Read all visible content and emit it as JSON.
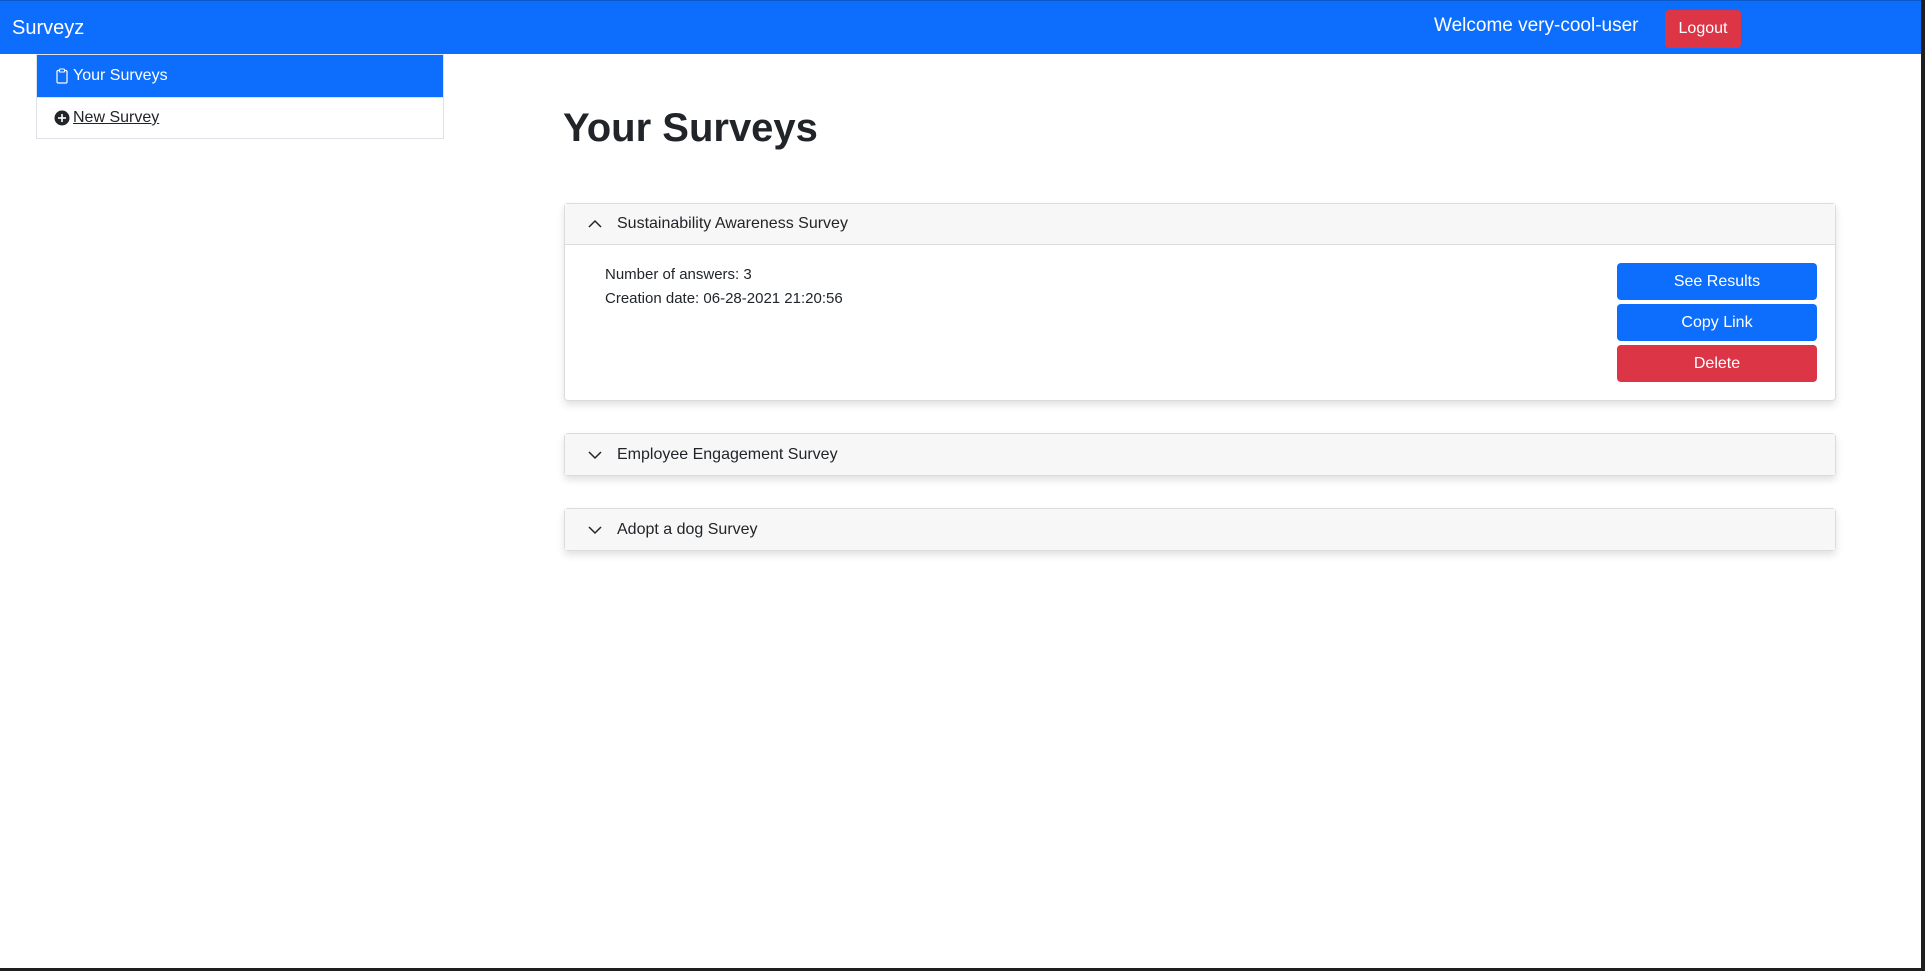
{
  "app": {
    "brand": "Surveyz",
    "welcome": "Welcome very-cool-user",
    "logout_label": "Logout"
  },
  "sidebar": {
    "items": [
      {
        "label": "Your Surveys",
        "icon": "clipboard-icon",
        "active": true
      },
      {
        "label": " New Survey",
        "icon": "plus-circle-icon",
        "active": false
      }
    ]
  },
  "main": {
    "title": "Your Surveys",
    "surveys": [
      {
        "name": "Sustainability Awareness Survey",
        "expanded": true,
        "answers_text": "Number of answers: 3",
        "created_text": "Creation date: 06-28-2021 21:20:56",
        "actions": {
          "results_label": "See Results",
          "copy_label": "Copy Link",
          "delete_label": "Delete"
        }
      },
      {
        "name": "Employee Engagement Survey",
        "expanded": false
      },
      {
        "name": "Adopt a dog Survey",
        "expanded": false
      }
    ]
  },
  "colors": {
    "primary": "#0d6efd",
    "danger": "#dc3545",
    "accordion_header": "#f7f7f7"
  }
}
